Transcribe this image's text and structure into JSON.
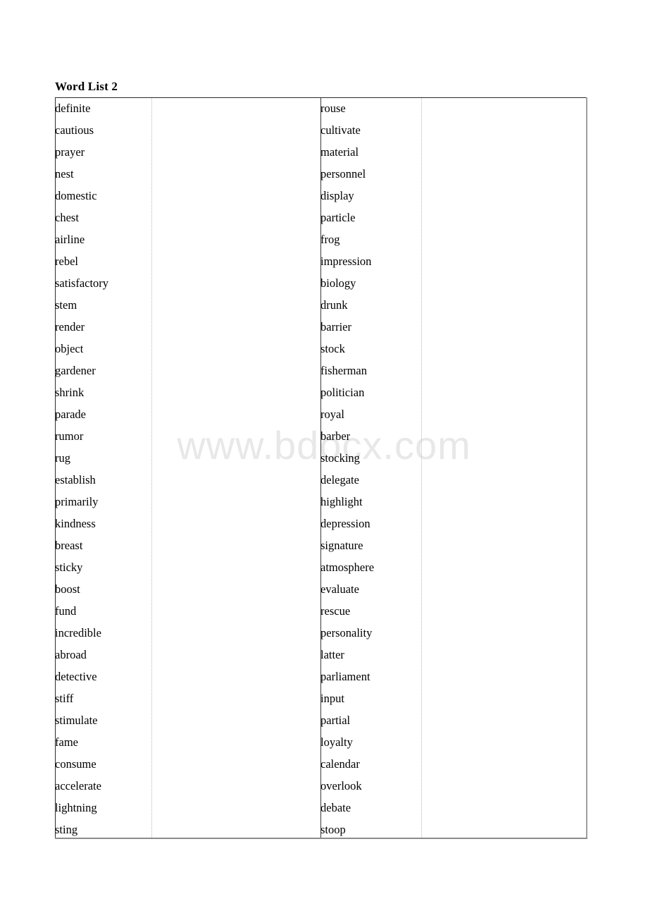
{
  "page": {
    "title": "Word List 2",
    "watermark": "www.bdocx.com",
    "background_color": "#ffffff",
    "text_color": "#000000",
    "watermark_color": "#e8e8e8",
    "border_color": "#2b2b2b",
    "divider_dotted_color": "#b9b9b9"
  },
  "table": {
    "columns": [
      {
        "name": "words-left",
        "type": "words"
      },
      {
        "name": "blank-left",
        "type": "blank"
      },
      {
        "name": "words-right",
        "type": "words"
      },
      {
        "name": "blank-right",
        "type": "blank"
      }
    ],
    "row_count": 34,
    "column_1_words": [
      "definite",
      "cautious",
      "prayer",
      "nest",
      "domestic",
      "chest",
      "airline",
      "rebel",
      "satisfactory",
      "stem",
      "render",
      "object",
      "gardener",
      "shrink",
      "parade",
      "rumor",
      "rug",
      "establish",
      "primarily",
      "kindness",
      "breast",
      "sticky",
      "boost",
      "fund",
      "incredible",
      "abroad",
      "detective",
      "stiff",
      "stimulate",
      "fame",
      "consume",
      "accelerate",
      "lightning",
      "sting"
    ],
    "column_2_words": [
      "",
      "",
      "",
      "",
      "",
      "",
      "",
      "",
      "",
      "",
      "",
      "",
      "",
      "",
      "",
      "",
      "",
      "",
      "",
      "",
      "",
      "",
      "",
      "",
      "",
      "",
      "",
      "",
      "",
      "",
      "",
      "",
      "",
      ""
    ],
    "column_3_words": [
      "rouse",
      "cultivate",
      "material",
      "personnel",
      "display",
      "particle",
      "frog",
      "impression",
      "biology",
      "drunk",
      "barrier",
      "stock",
      "fisherman",
      "politician",
      "royal",
      "barber",
      "stocking",
      "delegate",
      "highlight",
      "depression",
      "signature",
      "atmosphere",
      "evaluate",
      "rescue",
      "personality",
      "latter",
      "parliament",
      "input",
      "partial",
      "loyalty",
      "calendar",
      "overlook",
      "debate",
      "stoop"
    ],
    "column_4_words": [
      "",
      "",
      "",
      "",
      "",
      "",
      "",
      "",
      "",
      "",
      "",
      "",
      "",
      "",
      "",
      "",
      "",
      "",
      "",
      "",
      "",
      "",
      "",
      "",
      "",
      "",
      "",
      "",
      "",
      "",
      "",
      "",
      "",
      ""
    ]
  }
}
